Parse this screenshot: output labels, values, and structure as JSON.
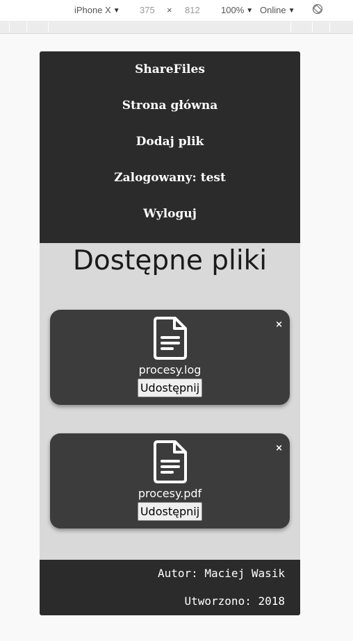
{
  "devtools": {
    "device": "iPhone X",
    "width": "375",
    "times": "×",
    "height": "812",
    "zoom": "100%",
    "network": "Online",
    "rotate_icon": "rotate-icon"
  },
  "nav": {
    "brand": "ShareFiles",
    "home": "Strona główna",
    "add_file": "Dodaj plik",
    "logged_in": "Zalogowany: test",
    "logout": "Wyloguj"
  },
  "page": {
    "title": "Dostępne pliki"
  },
  "files": [
    {
      "name": "procesy.log",
      "share_label": "Udostępnij",
      "close": "×"
    },
    {
      "name": "procesy.pdf",
      "share_label": "Udostępnij",
      "close": "×"
    }
  ],
  "footer": {
    "author": "Autor: Maciej Wasik",
    "created": "Utworzono: 2018"
  },
  "colors": {
    "nav_bg": "#2b2b2b",
    "content_bg": "#d9d9d9",
    "card_bg": "#3c3c3c",
    "text_light": "#ffffff"
  }
}
